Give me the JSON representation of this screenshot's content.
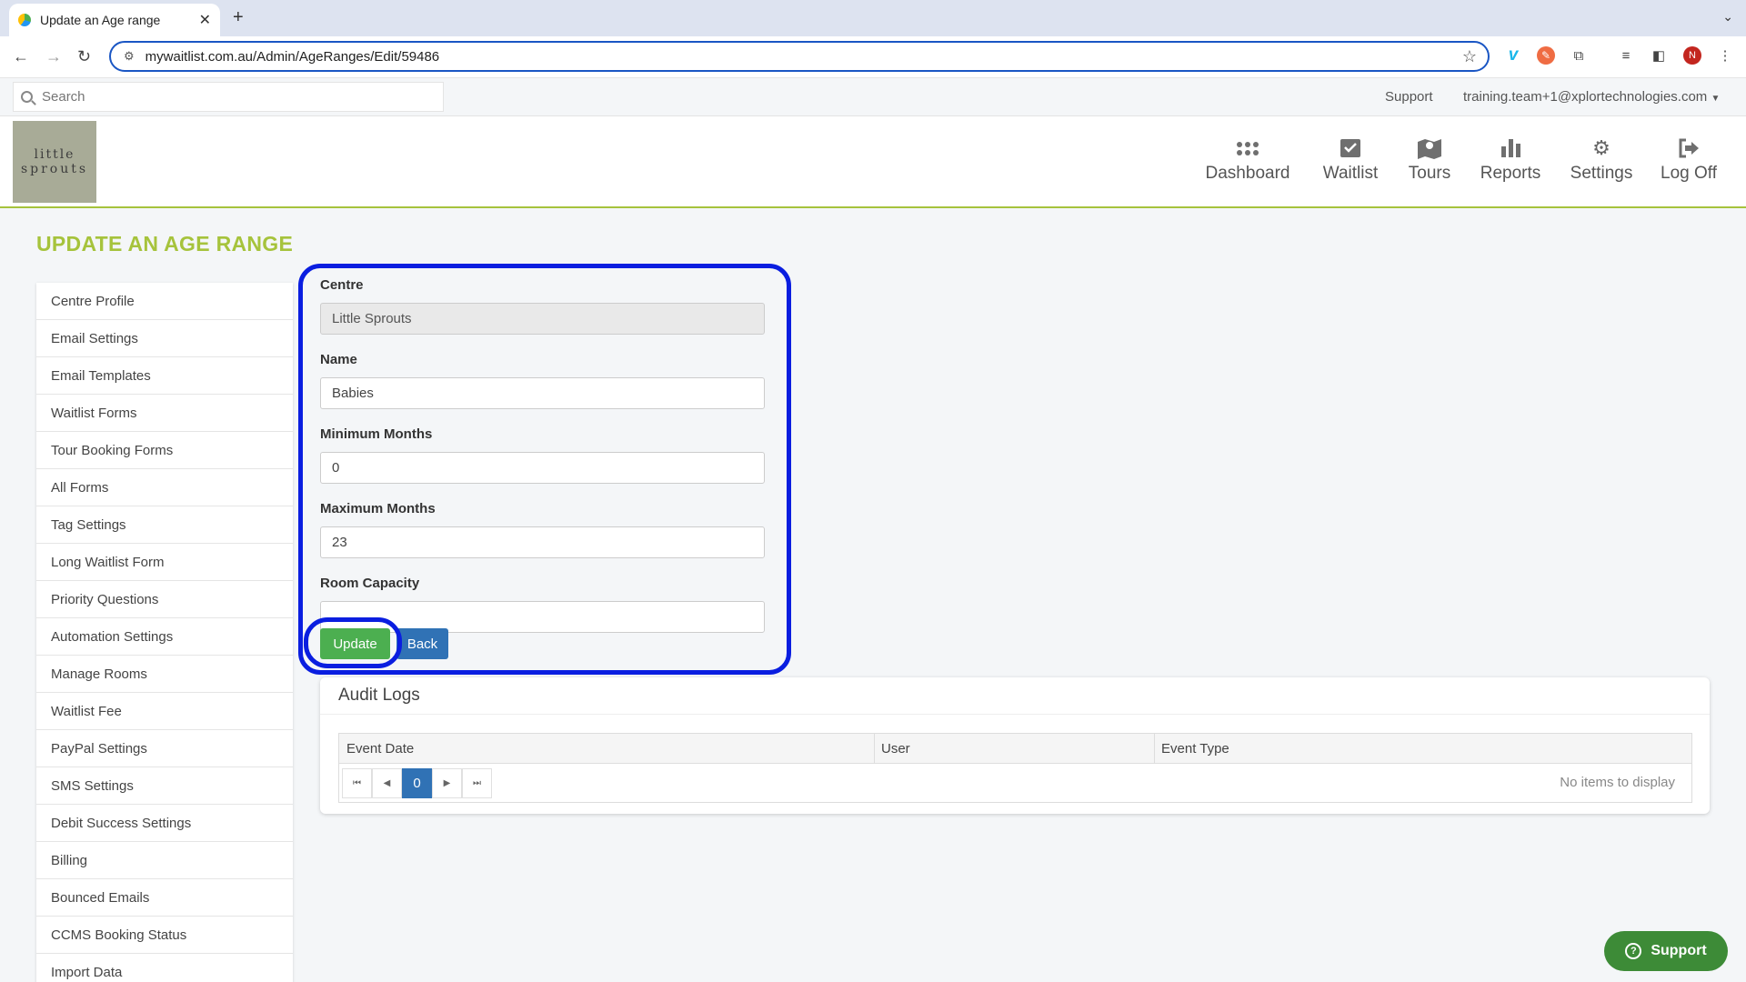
{
  "browser": {
    "tab_title": "Update an Age range",
    "url": "mywaitlist.com.au/Admin/AgeRanges/Edit/59486",
    "avatar_letter": "N"
  },
  "topbar": {
    "search_placeholder": "Search",
    "support_label": "Support",
    "user_email": "training.team+1@xplortechnologies.com"
  },
  "logo": {
    "line1": "little",
    "line2": "sprouts"
  },
  "nav": {
    "dashboard": "Dashboard",
    "waitlist": "Waitlist",
    "tours": "Tours",
    "reports": "Reports",
    "settings": "Settings",
    "logoff": "Log Off"
  },
  "page": {
    "title": "UPDATE AN AGE RANGE"
  },
  "sidebar": {
    "items": [
      "Centre Profile",
      "Email Settings",
      "Email Templates",
      "Waitlist Forms",
      "Tour Booking Forms",
      "All Forms",
      "Tag Settings",
      "Long Waitlist Form",
      "Priority Questions",
      "Automation Settings",
      "Manage Rooms",
      "Waitlist Fee",
      "PayPal Settings",
      "SMS Settings",
      "Debit Success Settings",
      "Billing",
      "Bounced Emails",
      "CCMS Booking Status",
      "Import Data"
    ]
  },
  "form": {
    "centre_label": "Centre",
    "centre_value": "Little Sprouts",
    "name_label": "Name",
    "name_value": "Babies",
    "min_label": "Minimum Months",
    "min_value": "0",
    "max_label": "Maximum Months",
    "max_value": "23",
    "capacity_label": "Room Capacity",
    "capacity_value": "",
    "update_label": "Update",
    "back_label": "Back"
  },
  "audit": {
    "title": "Audit Logs",
    "columns": [
      "Event Date",
      "User",
      "Event Type"
    ],
    "current_page": "0",
    "empty_text": "No items to display"
  },
  "support_widget": {
    "label": "Support"
  },
  "colors": {
    "accent_green": "#a6c33c",
    "update_button": "#4caf50",
    "back_button": "#3072b5",
    "highlight": "#0a1ee0"
  }
}
